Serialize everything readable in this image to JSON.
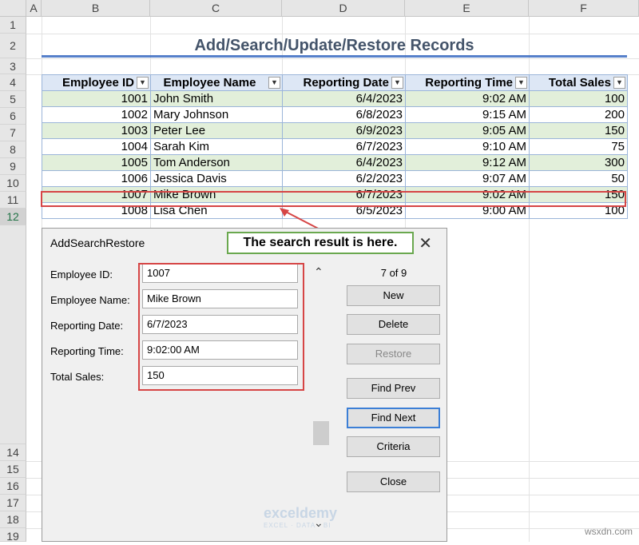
{
  "columns": [
    "A",
    "B",
    "C",
    "D",
    "E",
    "F"
  ],
  "rows_top": [
    "1",
    "2",
    "3",
    "4",
    "5",
    "6",
    "7",
    "8",
    "9",
    "10",
    "11",
    "12"
  ],
  "rows_bottom": [
    "14",
    "15",
    "16",
    "17",
    "18",
    "19"
  ],
  "sheet_title": "Add/Search/Update/Restore Records",
  "table": {
    "headers": [
      "Employee ID",
      "Employee Name",
      "Reporting Date",
      "Reporting Time",
      "Total Sales"
    ],
    "rows": [
      [
        "1001",
        "John Smith",
        "6/4/2023",
        "9:02 AM",
        "100"
      ],
      [
        "1002",
        "Mary Johnson",
        "6/8/2023",
        "9:15 AM",
        "200"
      ],
      [
        "1003",
        "Peter Lee",
        "6/9/2023",
        "9:05 AM",
        "150"
      ],
      [
        "1004",
        "Sarah Kim",
        "6/7/2023",
        "9:10 AM",
        "75"
      ],
      [
        "1005",
        "Tom Anderson",
        "6/4/2023",
        "9:12 AM",
        "300"
      ],
      [
        "1006",
        "Jessica Davis",
        "6/2/2023",
        "9:07 AM",
        "50"
      ],
      [
        "1007",
        "Mike Brown",
        "6/7/2023",
        "9:02 AM",
        "150"
      ],
      [
        "1008",
        "Lisa Chen",
        "6/5/2023",
        "9:00 AM",
        "100"
      ]
    ]
  },
  "dialog": {
    "title": "AddSearchRestore",
    "close": "✕",
    "labels": [
      "Employee ID:",
      "Employee Name:",
      "Reporting Date:",
      "Reporting Time:",
      "Total Sales:"
    ],
    "values": [
      "1007",
      "Mike Brown",
      "6/7/2023",
      "9:02:00 AM",
      "150"
    ],
    "counter": "7 of 9",
    "buttons": {
      "new": "New",
      "delete": "Delete",
      "restore": "Restore",
      "find_prev": "Find Prev",
      "find_next": "Find Next",
      "criteria": "Criteria",
      "close": "Close"
    }
  },
  "callout": "The search result is here.",
  "watermark": {
    "name": "exceldemy",
    "tag": "EXCEL · DATA · BI"
  },
  "footer": "wsxdn.com",
  "colors": {
    "highlight": "#d64545",
    "callout_border": "#6aa84f",
    "band": "#e2efda",
    "focus": "#3c7fd6"
  }
}
